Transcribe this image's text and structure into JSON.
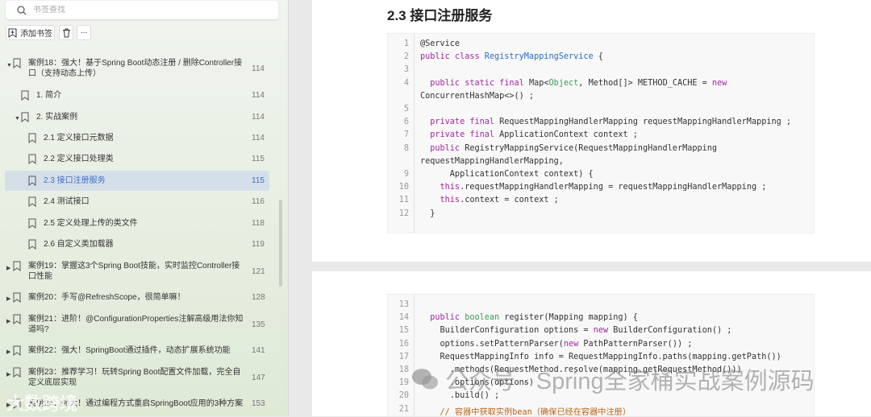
{
  "sidebar": {
    "search_placeholder": "书签查找",
    "add_bookmark": "添加书签",
    "items": [
      {
        "label": "案例18：强大！基于Spring Boot动态注册 / 删除Controller接口（支持动态上传）",
        "page": "114",
        "level": 0,
        "expanded": true
      },
      {
        "label": "1. 简介",
        "page": "114",
        "level": 1
      },
      {
        "label": "2. 实战案例",
        "page": "114",
        "level": 1,
        "expanded": true
      },
      {
        "label": "2.1 定义接口元数据",
        "page": "114",
        "level": 2
      },
      {
        "label": "2.2 定义接口处理类",
        "page": "115",
        "level": 2
      },
      {
        "label": "2.3 接口注册服务",
        "page": "115",
        "level": 2,
        "selected": true
      },
      {
        "label": "2.4 测试接口",
        "page": "116",
        "level": 2
      },
      {
        "label": "2.5 定义处理上传的类文件",
        "page": "118",
        "level": 2
      },
      {
        "label": "2.6 自定义类加载器",
        "page": "119",
        "level": 2
      },
      {
        "label": "案例19：掌握这3个Spring Boot技能，实时监控Controller接口性能",
        "page": "121",
        "level": 0,
        "collapsed": true
      },
      {
        "label": "案例20：手写@RefreshScope，很简单嘛！",
        "page": "128",
        "level": 0,
        "collapsed": true
      },
      {
        "label": "案例21：进阶！@ConfigurationProperties注解高级用法你知道吗?",
        "page": "135",
        "level": 0,
        "collapsed": true
      },
      {
        "label": "案例22：强大！SpringBoot通过插件，动态扩展系统功能",
        "page": "141",
        "level": 0,
        "collapsed": true
      },
      {
        "label": "案例23：推荐学习！玩转Spring Boot配置文件加载，完全自定义底层实现",
        "page": "147",
        "level": 0,
        "collapsed": true
      },
      {
        "label": "案例24：强大！通过编程方式重启SpringBoot应用的3种方案",
        "page": "153",
        "level": 0,
        "collapsed": true
      }
    ]
  },
  "main": {
    "heading": "2.3 接口注册服务",
    "block1": [
      {
        "n": "1",
        "segs": [
          [
            "@Service",
            ""
          ]
        ]
      },
      {
        "n": "2",
        "segs": [
          [
            "public class ",
            "kw"
          ],
          [
            "RegistryMappingService",
            "ty"
          ],
          [
            " {",
            ""
          ]
        ]
      },
      {
        "n": "3",
        "segs": []
      },
      {
        "n": "4",
        "segs": [
          [
            "  public static final ",
            "kw"
          ],
          [
            "Map<",
            ""
          ],
          [
            "Object",
            "gr"
          ],
          [
            ", Method[]> METHOD_CACHE = ",
            ""
          ],
          [
            "new",
            "kw"
          ]
        ]
      },
      {
        "n": "",
        "segs": [
          [
            "ConcurrentHashMap<>() ;",
            ""
          ]
        ]
      },
      {
        "n": "5",
        "segs": []
      },
      {
        "n": "6",
        "segs": [
          [
            "  private final ",
            "kw"
          ],
          [
            "RequestMappingHandlerMapping requestMappingHandlerMapping ;",
            ""
          ]
        ]
      },
      {
        "n": "7",
        "segs": [
          [
            "  private final ",
            "kw"
          ],
          [
            "ApplicationContext context ;",
            ""
          ]
        ]
      },
      {
        "n": "8",
        "segs": [
          [
            "  public ",
            "kw"
          ],
          [
            "RegistryMappingService(RequestMappingHandlerMapping",
            ""
          ]
        ]
      },
      {
        "n": "",
        "segs": [
          [
            "requestMappingHandlerMapping,",
            ""
          ]
        ]
      },
      {
        "n": "9",
        "segs": [
          [
            "      ApplicationContext context) {",
            ""
          ]
        ]
      },
      {
        "n": "10",
        "segs": [
          [
            "    this",
            "kw"
          ],
          [
            ".requestMappingHandlerMapping = requestMappingHandlerMapping ;",
            ""
          ]
        ]
      },
      {
        "n": "11",
        "segs": [
          [
            "    this",
            "kw"
          ],
          [
            ".context = context ;",
            ""
          ]
        ]
      },
      {
        "n": "12",
        "segs": [
          [
            "  }",
            ""
          ]
        ]
      }
    ],
    "block2": [
      {
        "n": "13",
        "segs": []
      },
      {
        "n": "14",
        "segs": [
          [
            "  public ",
            "kw"
          ],
          [
            "boolean",
            "gr"
          ],
          [
            " register(Mapping mapping) {",
            ""
          ]
        ]
      },
      {
        "n": "15",
        "segs": [
          [
            "    BuilderConfiguration options = ",
            ""
          ],
          [
            "new",
            "kw"
          ],
          [
            " BuilderConfiguration() ;",
            ""
          ]
        ]
      },
      {
        "n": "16",
        "segs": [
          [
            "    options.setPatternParser(",
            ""
          ],
          [
            "new",
            "kw"
          ],
          [
            " PathPatternParser()) ;",
            ""
          ]
        ]
      },
      {
        "n": "17",
        "segs": [
          [
            "    RequestMappingInfo info = RequestMappingInfo.paths(mapping.getPath())",
            ""
          ]
        ]
      },
      {
        "n": "18",
        "segs": [
          [
            "      .methods(RequestMethod.resolve(mapping.getRequestMethod()))",
            ""
          ]
        ]
      },
      {
        "n": "19",
        "segs": [
          [
            "      .options(options)",
            ""
          ]
        ]
      },
      {
        "n": "20",
        "segs": [
          [
            "      .build() ;",
            ""
          ]
        ]
      },
      {
        "n": "21",
        "segs": [
          [
            "    // 容器中获取实例bean（确保已经在容器中注册）",
            "cm"
          ]
        ]
      }
    ]
  },
  "watermarks": {
    "wechat": "公众号 · Spring全家桶实战案例源码",
    "corner": "大数跨境"
  }
}
